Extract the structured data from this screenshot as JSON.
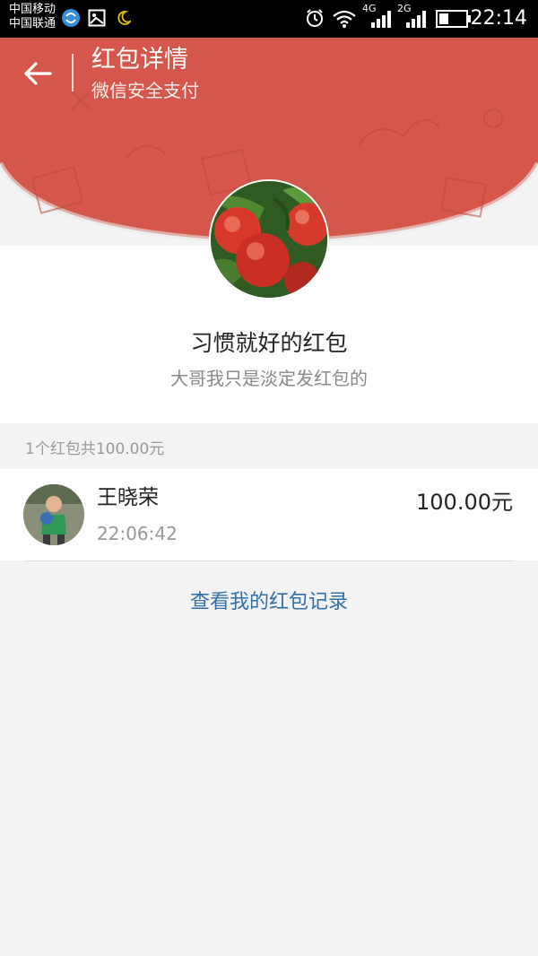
{
  "status_bar": {
    "carrier_1": "中国移动",
    "carrier_2": "中国联通",
    "network_1": "4G",
    "network_2": "2G",
    "time": "22:14",
    "icons": [
      "sync-icon",
      "image-icon",
      "moon-icon",
      "alarm-icon",
      "wifi-icon",
      "signal-icon",
      "battery-icon"
    ]
  },
  "header": {
    "title": "红包详情",
    "subtitle": "微信安全支付",
    "accent_color": "#d5574b"
  },
  "packet": {
    "sender_name": "习惯就好的红包",
    "greeting": "大哥我只是淡定发红包的",
    "summary": "1个红包共100.00元"
  },
  "records": [
    {
      "name": "王晓荣",
      "time": "22:06:42",
      "amount": "100.00元"
    }
  ],
  "footer": {
    "history_link": "查看我的红包记录",
    "link_color": "#2f6ea8"
  }
}
